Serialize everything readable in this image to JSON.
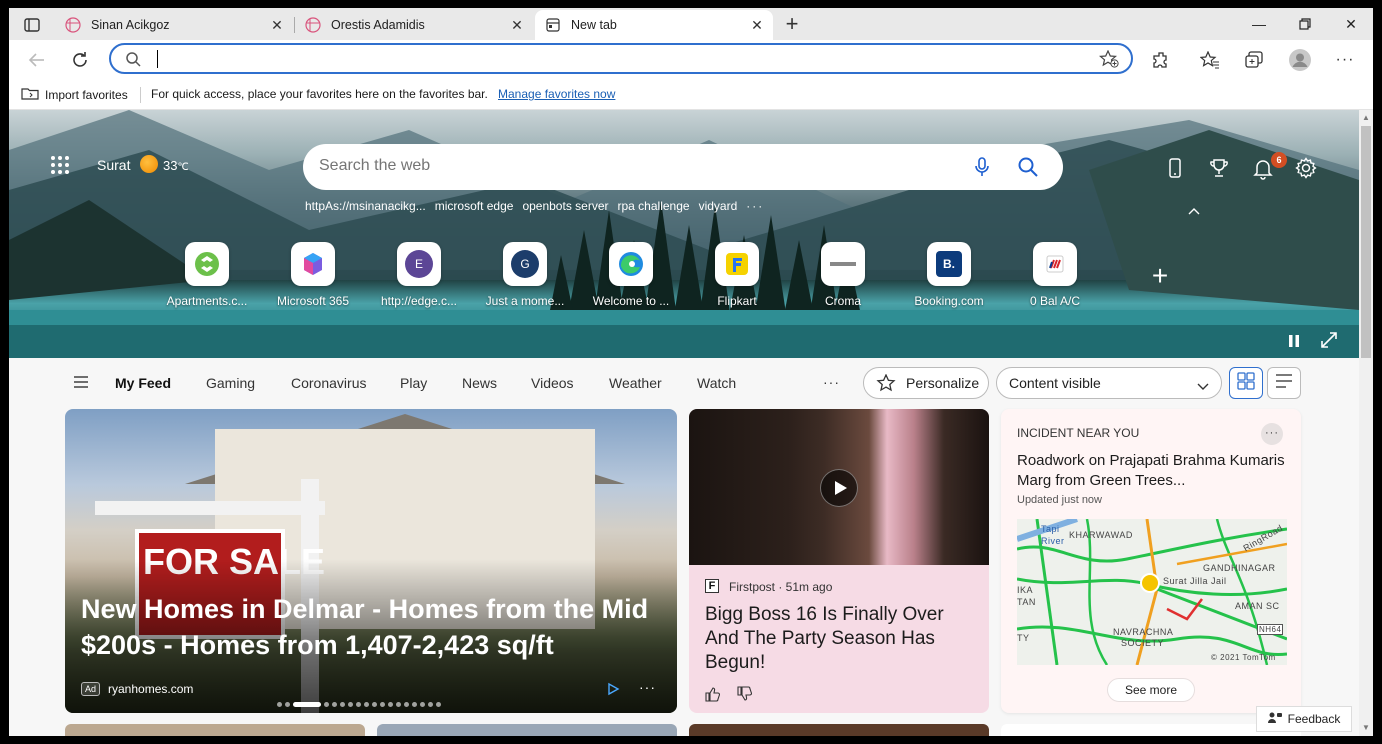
{
  "tabs": [
    {
      "title": "Sinan Acikgoz",
      "active": false
    },
    {
      "title": "Orestis Adamidis",
      "active": false
    },
    {
      "title": "New tab",
      "active": true
    }
  ],
  "address_bar": {
    "value": "",
    "placeholder": ""
  },
  "favorites_bar": {
    "import_label": "Import favorites",
    "hint": "For quick access, place your favorites here on the favorites bar.",
    "manage_link": "Manage favorites now"
  },
  "weather": {
    "city": "Surat",
    "temp": "33",
    "unit": "℃"
  },
  "search": {
    "placeholder": "Search the web"
  },
  "suggestions": [
    "httpAs://msinanacikg...",
    "microsoft edge",
    "openbots server",
    "rpa challenge",
    "vidyard"
  ],
  "notifications": {
    "count": "6"
  },
  "quick_links": [
    {
      "label": "Apartments.c...",
      "icon": "apartments-icon"
    },
    {
      "label": "Microsoft 365",
      "icon": "microsoft-365-icon"
    },
    {
      "label": "http://edge.c...",
      "icon": "letter-e-icon",
      "letter": "E"
    },
    {
      "label": "Just a mome...",
      "icon": "letter-g-icon",
      "letter": "G"
    },
    {
      "label": "Welcome to ...",
      "icon": "edge-icon"
    },
    {
      "label": "Flipkart",
      "icon": "flipkart-icon"
    },
    {
      "label": "Croma",
      "icon": "croma-icon"
    },
    {
      "label": "Booking.com",
      "icon": "booking-icon",
      "letter": "B."
    },
    {
      "label": "0 Bal A/C",
      "icon": "bank-icon"
    }
  ],
  "feed_nav": {
    "items": [
      "My Feed",
      "Gaming",
      "Coronavirus",
      "Play",
      "News",
      "Videos",
      "Weather",
      "Watch"
    ],
    "more": "···",
    "personalize": "Personalize",
    "content_select": "Content visible"
  },
  "cards": {
    "hero": {
      "headline": "New Homes in Delmar - Homes from the Mid $200s - Homes from 1,407-2,423 sq/ft",
      "ad_tag": "Ad",
      "source": "ryanhomes.com",
      "sign_text": "FOR SALE"
    },
    "video": {
      "publisher_logo": "F",
      "publisher": "Firstpost · 51m ago",
      "title": "Bigg Boss 16 Is Finally Over And The Party Season Has Begun!"
    },
    "incident": {
      "kicker": "INCIDENT NEAR YOU",
      "title": "Roadwork on Prajapati Brahma Kumaris Marg from Green Trees...",
      "updated": "Updated just now",
      "see_more": "See more",
      "map_labels": {
        "tapi": "Tapi",
        "river": "River",
        "kharwawad": "KHARWAWAD",
        "ringroad": "RingRoad",
        "gandhinagar": "GANDHINAGAR",
        "surat_jilla": "Surat Jilla Jail",
        "aman": "AMAN SC",
        "ika": "IKA",
        "tan": "TAN",
        "navrachna": "NAVRACHNA",
        "society": "SOCIETY",
        "ty": "TY",
        "nh64": "NH64",
        "copyright": "© 2021 TomTom"
      }
    }
  },
  "feedback": {
    "label": "Feedback"
  },
  "colors": {
    "accent": "#2f6fce",
    "badge": "#d24e23"
  }
}
